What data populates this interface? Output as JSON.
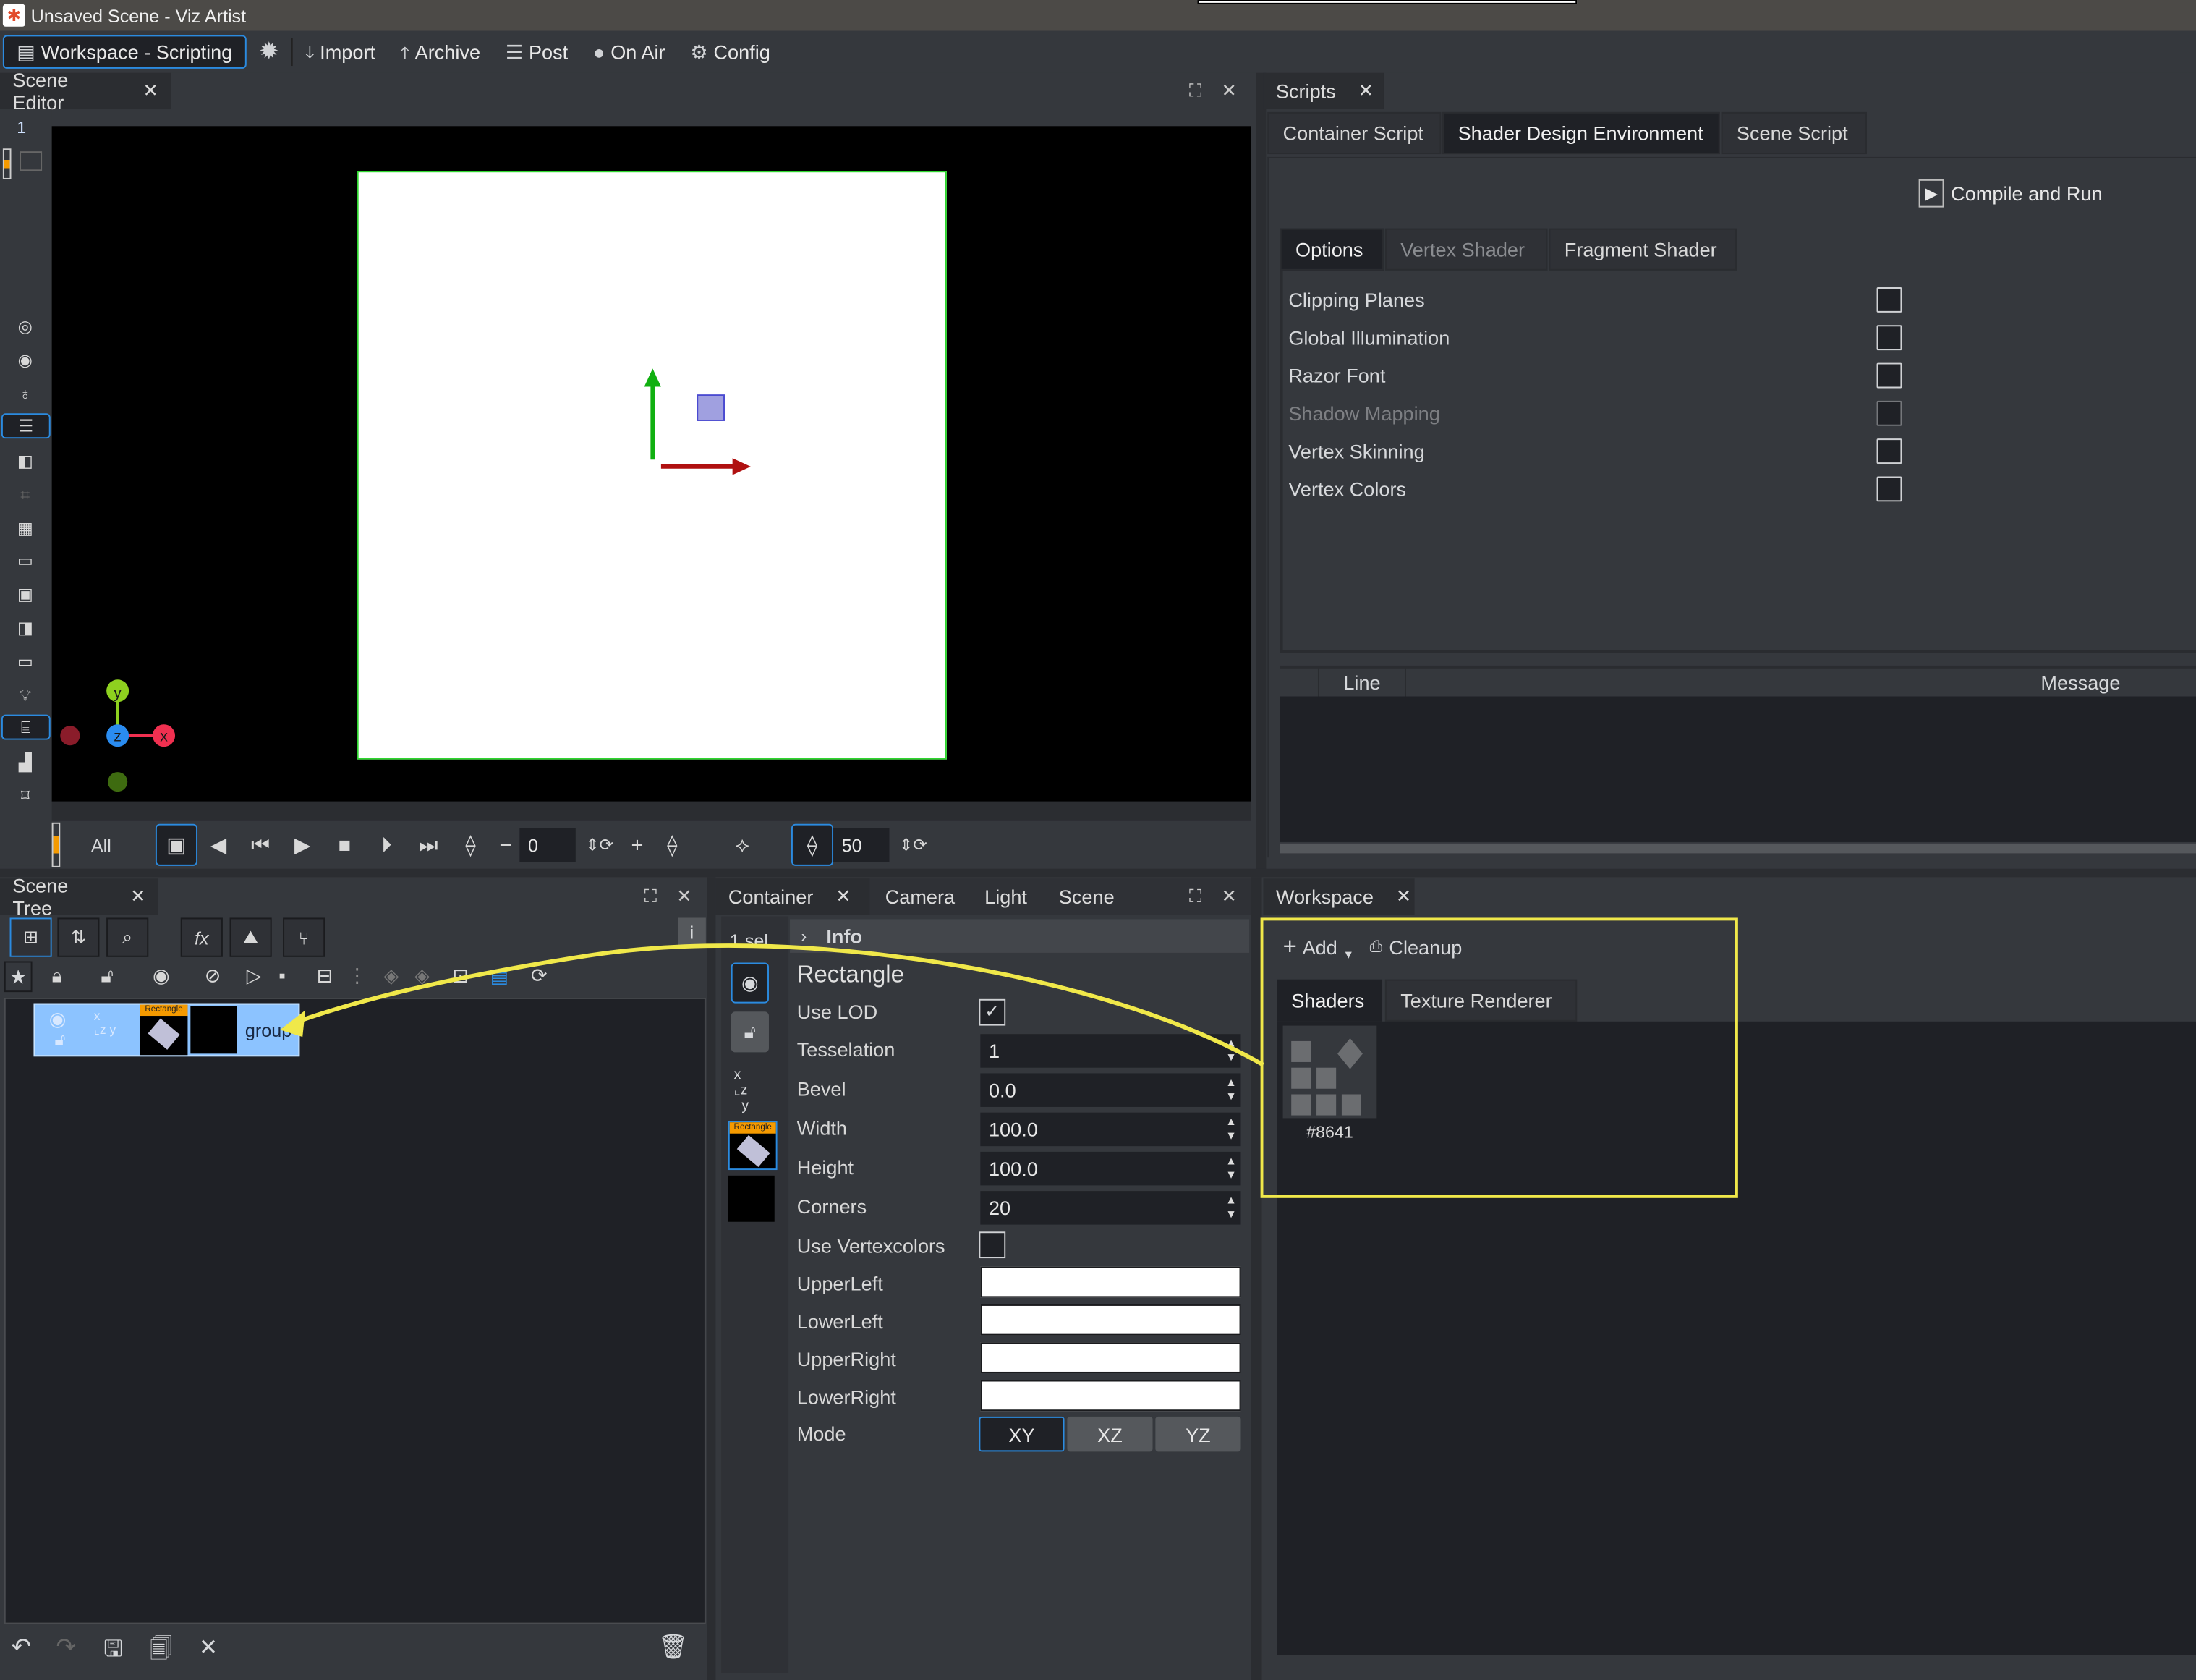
{
  "window": {
    "title": "Unsaved Scene - Viz Artist"
  },
  "menubar": {
    "workspace": "Workspace - Scripting",
    "items": [
      {
        "label": "Import",
        "icon": "import-icon"
      },
      {
        "label": "Archive",
        "icon": "archive-icon"
      },
      {
        "label": "Post",
        "icon": "post-icon"
      },
      {
        "label": "On Air",
        "icon": "on-air-icon"
      },
      {
        "label": "Config",
        "icon": "config-icon"
      }
    ]
  },
  "scene_editor": {
    "tab": "Scene Editor",
    "layer_number": "1",
    "gizmo": {
      "x": "x",
      "y": "y",
      "z": "z"
    },
    "timeline": {
      "filter": "All",
      "current_frame": "0",
      "step_value": "50"
    }
  },
  "scripts": {
    "tab": "Scripts",
    "tabs": [
      "Container Script",
      "Shader Design Environment",
      "Scene Script"
    ],
    "active_tab": "Shader Design Environment",
    "compile_button": "Compile and Run",
    "subtabs": [
      "Options",
      "Vertex Shader",
      "Fragment Shader"
    ],
    "options": [
      {
        "label": "Clipping Planes",
        "checked": false,
        "enabled": true
      },
      {
        "label": "Global Illumination",
        "checked": false,
        "enabled": true
      },
      {
        "label": "Razor Font",
        "checked": false,
        "enabled": true
      },
      {
        "label": "Shadow Mapping",
        "checked": false,
        "enabled": false
      },
      {
        "label": "Vertex Skinning",
        "checked": false,
        "enabled": true
      },
      {
        "label": "Vertex Colors",
        "checked": false,
        "enabled": true
      }
    ],
    "messages": {
      "columns": [
        "",
        "Line",
        "Message"
      ],
      "rows": []
    }
  },
  "scene_tree": {
    "tab": "Scene Tree",
    "node": {
      "name": "group",
      "geometry_label": "Rectangle"
    }
  },
  "container": {
    "tabs": [
      "Container",
      "Camera",
      "Light",
      "Scene"
    ],
    "selection": "1 sel.",
    "info_header": "Info",
    "plugin_title": "Rectangle",
    "geometry_badge": "Rectangle",
    "properties": {
      "use_lod": {
        "label": "Use LOD",
        "checked": true
      },
      "tesselation": {
        "label": "Tesselation",
        "value": "1"
      },
      "bevel": {
        "label": "Bevel",
        "value": "0.0"
      },
      "width": {
        "label": "Width",
        "value": "100.0"
      },
      "height": {
        "label": "Height",
        "value": "100.0"
      },
      "corners": {
        "label": "Corners",
        "value": "20"
      },
      "use_vertexcolors": {
        "label": "Use Vertexcolors",
        "checked": false
      },
      "upper_left": {
        "label": "UpperLeft",
        "color": "#ffffff"
      },
      "lower_left": {
        "label": "LowerLeft",
        "color": "#ffffff"
      },
      "upper_right": {
        "label": "UpperRight",
        "color": "#ffffff"
      },
      "lower_right": {
        "label": "LowerRight",
        "color": "#ffffff"
      },
      "mode": {
        "label": "Mode",
        "options": [
          "XY",
          "XZ",
          "YZ"
        ],
        "selected": "XY"
      }
    }
  },
  "workspace": {
    "tab": "Workspace",
    "add_label": "Add",
    "cleanup_label": "Cleanup",
    "tabs": [
      "Shaders",
      "Texture Renderer"
    ],
    "active_tab": "Shaders",
    "items": [
      {
        "label": "#8641"
      }
    ]
  },
  "colors": {
    "accent": "#2b8be0",
    "highlight": "#f0e84a",
    "selection": "#8cc3ff"
  }
}
